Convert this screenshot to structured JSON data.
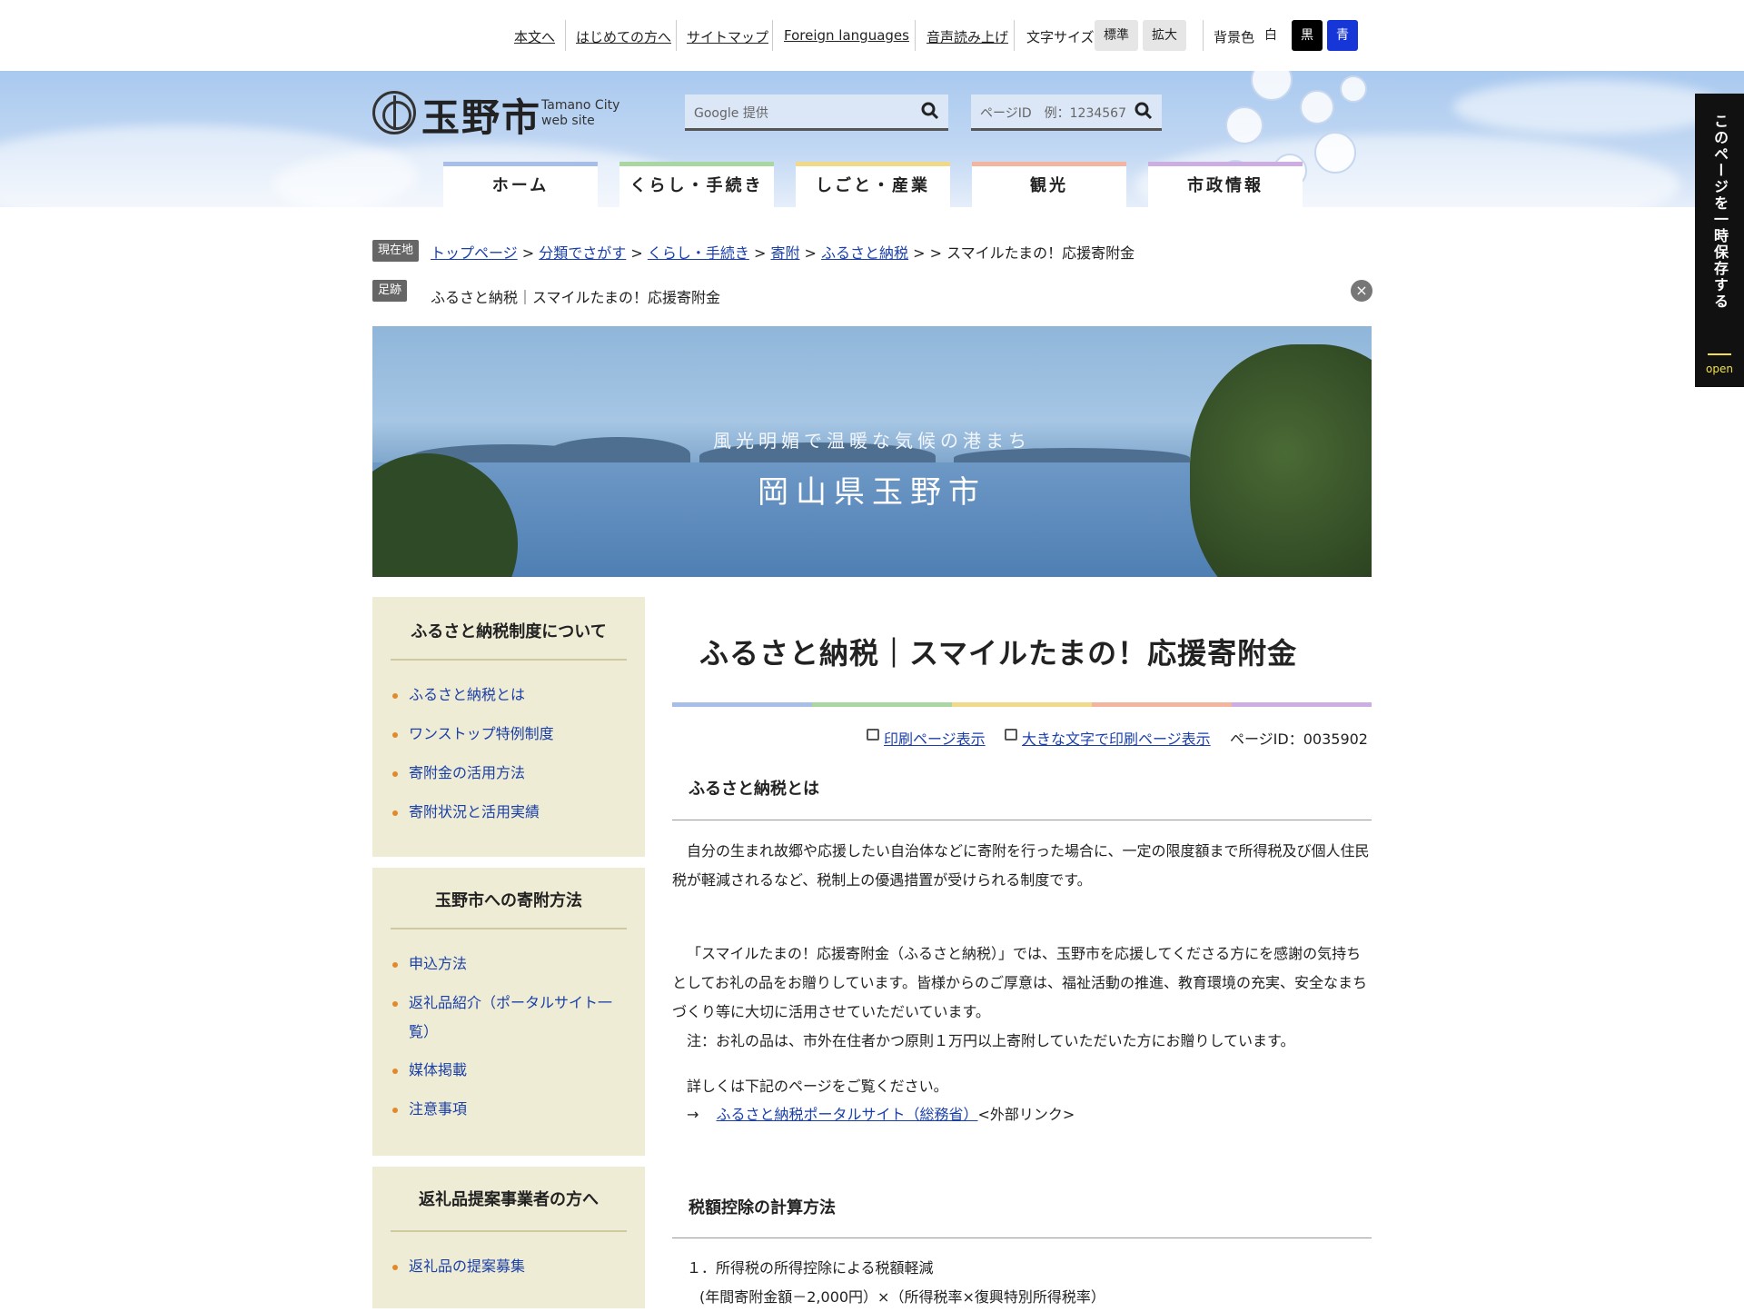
{
  "util": {
    "skip": "本文へ",
    "first_time": "はじめての方へ",
    "sitemap": "サイトマップ",
    "foreign": "Foreign languages",
    "speech": "音声読み上げ",
    "font_label": "文字サイズ",
    "font_std": "標準",
    "font_large": "拡大",
    "bg_label": "背景色",
    "bg_white": "白",
    "bg_black": "黒",
    "bg_blue": "青"
  },
  "header": {
    "logo": "玉野市",
    "logo_sub_1": "Tamano City",
    "logo_sub_2": "web site",
    "google_placeholder": "Google 提供",
    "pageid_placeholder": "ページID　例：1234567"
  },
  "nav": [
    "ホーム",
    "くらし・手続き",
    "しごと・産業",
    "観光",
    "市政情報"
  ],
  "nav_colors": [
    "#a7bfe8",
    "#a8d7a2",
    "#f1d98a",
    "#f3b5a0",
    "#cdaee2"
  ],
  "breadcrumb": {
    "tag": "現在地",
    "items": [
      "トップページ",
      "分類でさがす",
      "くらし・手続き",
      "寄附",
      "ふるさと納税"
    ],
    "current": "スマイルたまの！応援寄附金",
    "footprint_tag": "足跡",
    "footprint": "ふるさと納税｜スマイルたまの！応援寄附金"
  },
  "hero": {
    "subtitle": "風光明媚で温暖な気候の港まち",
    "title": "岡山県玉野市"
  },
  "side": [
    {
      "heading": "ふるさと納税制度について",
      "items": [
        "ふるさと納税とは",
        "ワンストップ特例制度",
        "寄附金の活用方法",
        "寄附状況と活用実績"
      ]
    },
    {
      "heading": "玉野市への寄附方法",
      "items": [
        "申込方法",
        "返礼品紹介（ポータルサイト一覧）",
        "媒体掲載",
        "注意事項"
      ]
    },
    {
      "heading": "返礼品提案事業者の方へ",
      "items": [
        "返礼品の提案募集"
      ]
    }
  ],
  "main": {
    "title": "ふるさと納税｜スマイルたまの！応援寄附金",
    "print": "印刷ページ表示",
    "print_large": "大きな文字で印刷ページ表示",
    "page_id": "ページID：0035902",
    "section1": "ふるさと納税とは",
    "p1": "自分の生まれ故郷や応援したい自治体などに寄附を行った場合に、一定の限度額まで所得税及び個人住民税が軽減されるなど、税制上の優遇措置が受けられる制度です。",
    "p2": "「スマイルたまの！応援寄附金（ふるさと納税）」では、玉野市を応援してくださる方にを感謝の気持ちとしてお礼の品をお贈りしています。皆様からのご厚意は、福祉活動の推進、教育環境の充実、安全なまちづくり等に大切に活用させていただいています。",
    "p3": "注：お礼の品は、市外在住者かつ原則１万円以上寄附していただいた方にお贈りしています。",
    "p4": "詳しくは下記のページをご覧ください。",
    "arrow": "→",
    "ext_link": "ふるさと納税ポータルサイト（総務省）",
    "ext_label": "<外部リンク>",
    "section2": "税額控除の計算方法",
    "calc1": "１．所得税の所得控除による税額軽減",
    "calc1_formula": "(年間寄附金額－2,000円）×（所得税率×復興特別所得税率）"
  },
  "savetab": {
    "label": "このページを一時保存する",
    "open": "open"
  }
}
